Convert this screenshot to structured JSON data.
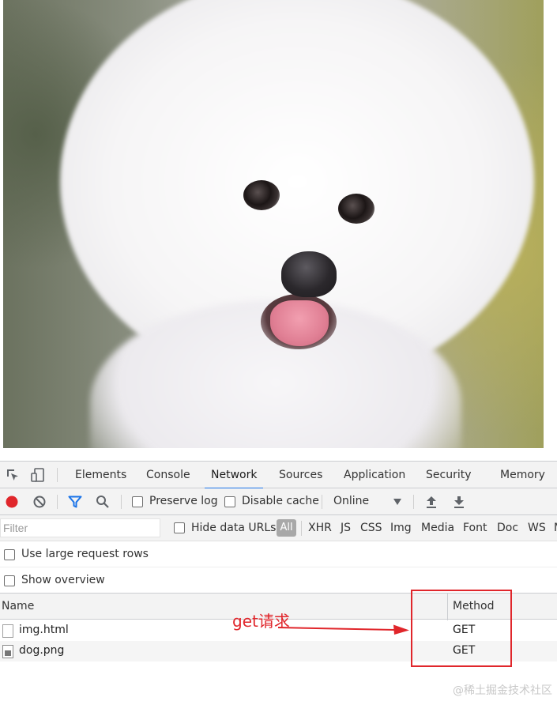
{
  "devtools": {
    "tabs": [
      "Elements",
      "Console",
      "Network",
      "Sources",
      "Application",
      "Security",
      "Memory"
    ],
    "active_tab": "Network",
    "toolbar": {
      "preserve_log": "Preserve log",
      "disable_cache": "Disable cache",
      "throttling": "Online"
    },
    "filter": {
      "placeholder": "Filter",
      "hide_data_urls": "Hide data URLs",
      "types": [
        "All",
        "XHR",
        "JS",
        "CSS",
        "Img",
        "Media",
        "Font",
        "Doc",
        "WS",
        "M"
      ]
    },
    "options": {
      "large_rows": "Use large request rows",
      "show_overview": "Show overview"
    },
    "table": {
      "headers": {
        "name": "Name",
        "method": "Method"
      },
      "rows": [
        {
          "name": "img.html",
          "method": "GET"
        },
        {
          "name": "dog.png",
          "method": "GET"
        }
      ]
    }
  },
  "annotation": {
    "text": "get请求",
    "color": "#e0262b"
  },
  "watermark": "@稀土掘金技术社区",
  "colors": {
    "record": "#e0262b",
    "accent": "#1a73e8",
    "filter_icon": "#1a73e8"
  }
}
